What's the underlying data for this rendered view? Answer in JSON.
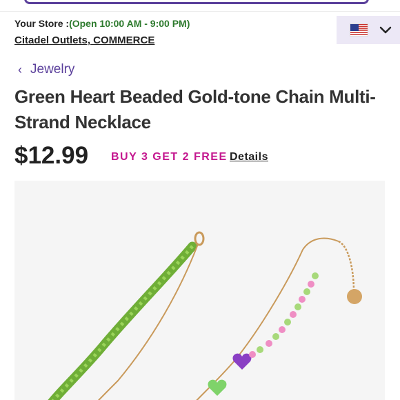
{
  "store": {
    "label": "Your Store :",
    "hours": "(Open 10:00 AM - 9:00 PM)",
    "location": "Citadel Outlets, COMMERCE"
  },
  "locale": {
    "flag_icon": "us-flag-icon",
    "chevron_icon": "chevron-down-icon"
  },
  "breadcrumb": {
    "label": "Jewelry"
  },
  "product": {
    "title": "Green Heart Beaded Gold-tone Chain Multi-Strand Necklace",
    "price": "$12.99",
    "promo": "BUY 3 GET 2 FREE",
    "details_link": "Details"
  },
  "colors": {
    "accent_purple": "#5a3f9b",
    "promo_pink": "#c4178f",
    "store_hours_green": "#2d7a2d",
    "locale_bg": "#ece8f6"
  }
}
